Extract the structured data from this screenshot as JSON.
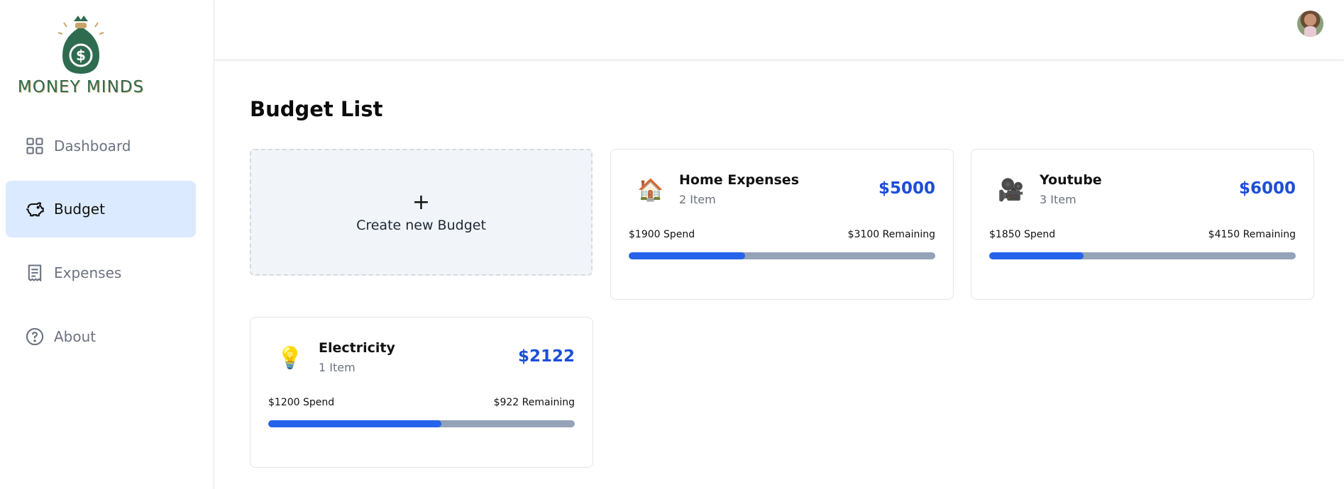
{
  "brand": {
    "name": "MONEY MINDS"
  },
  "sidebar": {
    "items": [
      {
        "label": "Dashboard",
        "icon": "dashboard-grid-icon",
        "active": false
      },
      {
        "label": "Budget",
        "icon": "piggy-bank-icon",
        "active": true
      },
      {
        "label": "Expenses",
        "icon": "receipt-icon",
        "active": false
      },
      {
        "label": "About",
        "icon": "question-circle-icon",
        "active": false
      }
    ]
  },
  "header": {
    "avatar": "user-avatar"
  },
  "main": {
    "title": "Budget List",
    "create": {
      "plus": "+",
      "label": "Create new Budget"
    },
    "budgets": [
      {
        "emoji": "🏠",
        "name": "Home Expenses",
        "items": "2 Item",
        "amount": "$5000",
        "spend": "$1900 Spend",
        "remaining": "$3100 Remaining",
        "progress": 0.38
      },
      {
        "emoji": "🎥",
        "name": "Youtube",
        "items": "3 Item",
        "amount": "$6000",
        "spend": "$1850 Spend",
        "remaining": "$4150 Remaining",
        "progress": 0.308
      },
      {
        "emoji": "💡",
        "name": "Electricity",
        "items": "1 Item",
        "amount": "$2122",
        "spend": "$1200 Spend",
        "remaining": "$922 Remaining",
        "progress": 0.565
      }
    ]
  },
  "colors": {
    "accent": "#1d4ed8",
    "progress": "#2563eb",
    "track": "#94a3b8",
    "active_nav": "#dbeafe",
    "brand": "#2f6b4f"
  }
}
